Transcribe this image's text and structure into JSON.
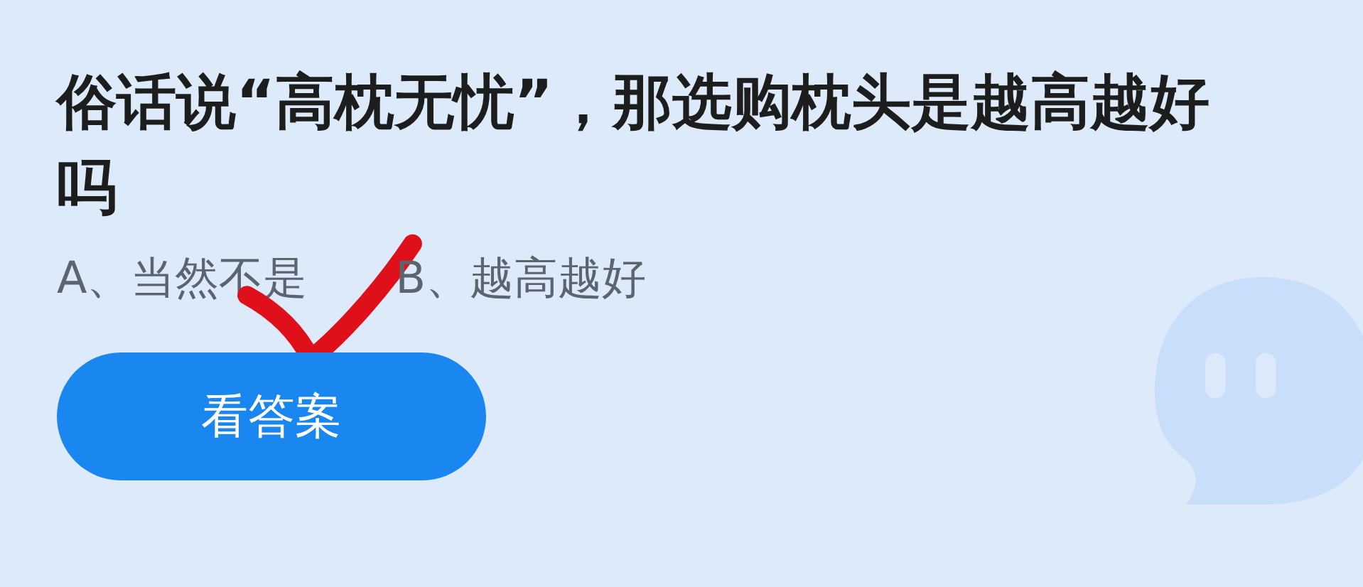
{
  "question": "俗话说“高枕无忧”，那选购枕头是越高越好吗",
  "options": [
    {
      "text": "A、当然不是",
      "marked": true
    },
    {
      "text": "B、越高越好",
      "marked": false
    }
  ],
  "button": {
    "label": "看答案"
  }
}
